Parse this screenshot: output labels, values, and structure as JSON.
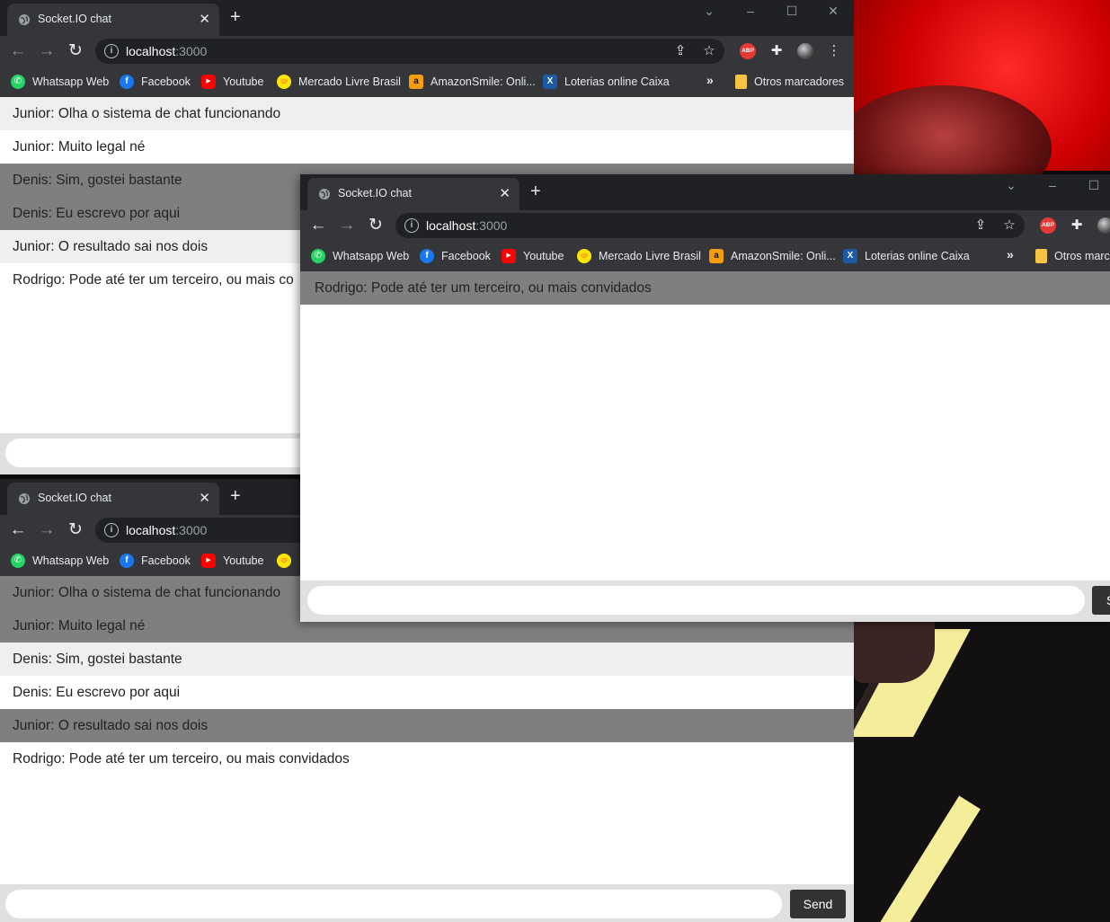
{
  "colors": {
    "tab_strip": "#202124",
    "toolbar": "#35363a",
    "msg_even": "#efefef",
    "msg_odd": "#ffffff",
    "msg_highlight": "#7f7f7f",
    "send_button": "#333333"
  },
  "browser": {
    "tab_title": "Socket.IO chat",
    "new_tab": "+",
    "url_host": "localhost",
    "url_port": ":3000",
    "more_bookmarks": "»",
    "window_controls": [
      "⌄",
      "–",
      "☐",
      "✕"
    ]
  },
  "bookmarks": [
    {
      "label": "Whatsapp Web",
      "icon": "whatsapp-icon"
    },
    {
      "label": "Facebook",
      "icon": "facebook-icon"
    },
    {
      "label": "Youtube",
      "icon": "youtube-icon"
    },
    {
      "label": "Mercado Livre Brasil",
      "icon": "mercadolivre-icon"
    },
    {
      "label": "AmazonSmile: Onli...",
      "icon": "amazon-icon"
    },
    {
      "label": "Loterias online Caixa",
      "icon": "loterias-icon"
    }
  ],
  "other_bookmarks": "Otros marcadores",
  "other_bookmarks_clipped": "Otros marc",
  "chat": {
    "send_label": "Send",
    "send_label_clipped": "S",
    "messages": [
      "Junior: Olha o sistema de chat funcionando",
      "Junior: Muito legal né",
      "Denis: Sim, gostei bastante",
      "Denis: Eu escrevo por aqui",
      "Junior: O resultado sai nos dois",
      "Rodrigo: Pode até ter um terceiro, ou mais convidados"
    ],
    "messages_clipped": [
      "Junior: Olha o sistema de chat funcionando",
      "Junior: Muito legal né",
      "Denis: Sim, gostei bastante",
      "Denis: Eu escrevo por aqui",
      "Junior: O resultado sai nos dois",
      "Rodrigo: Pode até ter um terceiro, ou mais co"
    ],
    "third_window_messages": [
      "Rodrigo: Pode até ter um terceiro, ou mais convidados"
    ]
  }
}
